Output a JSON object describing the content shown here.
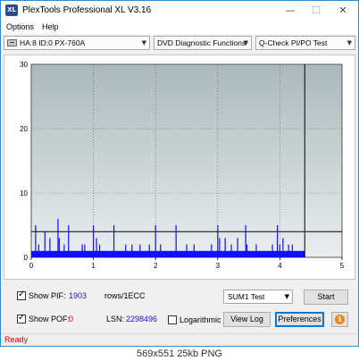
{
  "window": {
    "title": "PlexTools Professional XL V3.16",
    "icon_text": "XL",
    "controls": {
      "minimize": "—",
      "maximize": "☐",
      "close": "✕"
    }
  },
  "menu": {
    "options": "Options",
    "help": "Help"
  },
  "toolbar": {
    "drive": "HA:8 ID:0  PX-760A",
    "function": "DVD Diagnostic Functions",
    "test": "Q-Check PI/PO Test",
    "arrow": "▼"
  },
  "chart_data": {
    "type": "bar",
    "xlim": [
      0,
      5
    ],
    "ylim": [
      0,
      30
    ],
    "x_ticks": [
      "0",
      "1",
      "2",
      "3",
      "4",
      "5"
    ],
    "y_ticks": [
      "0",
      "10",
      "20",
      "30"
    ],
    "threshold_line": 4,
    "end_marker_x": 4.4,
    "colors": {
      "plot_top": "#a9b9bd",
      "plot_bottom": "#e9eeee",
      "bars": "#1010ff",
      "grid": "#5a5a5a"
    },
    "series": [
      {
        "x": [
          0.07,
          0.12,
          0.22,
          0.3,
          0.43,
          0.45,
          0.53,
          0.6,
          0.82,
          0.86,
          1.0,
          1.05,
          1.1,
          1.33,
          1.52,
          1.62,
          1.75,
          1.9,
          2.0,
          2.08,
          2.33,
          2.5,
          2.62,
          2.9,
          3.0,
          3.03,
          3.12,
          3.22,
          3.32,
          3.45,
          3.47,
          3.62,
          3.88,
          3.96,
          4.0,
          4.05,
          4.14,
          4.2
        ],
        "values": [
          5,
          2,
          4,
          3,
          6,
          3,
          2,
          5,
          2,
          2,
          5,
          3,
          2,
          5,
          2,
          2,
          2,
          2,
          5,
          2,
          5,
          2,
          2,
          2,
          5,
          3,
          3,
          2,
          3,
          5,
          2,
          2,
          2,
          5,
          2,
          3,
          2,
          2
        ]
      }
    ]
  },
  "controls": {
    "show_pif_label": "Show PIF:",
    "pif_value": "1903",
    "pif_unit": "rows/1ECC",
    "show_pof_label": "Show POF:",
    "pof_value": "0",
    "lsn_label": "LSN:",
    "lsn_value": "2298496",
    "logarithmic_label": "Logarithmic",
    "sum_select": "SUM1 Test",
    "start_button": "Start",
    "view_log_button": "View Log",
    "preferences_button": "Preferences",
    "info_icon": "i",
    "checkmark": "✓"
  },
  "status": {
    "text": "Ready"
  },
  "caption": "569x551  25kb  PNG"
}
